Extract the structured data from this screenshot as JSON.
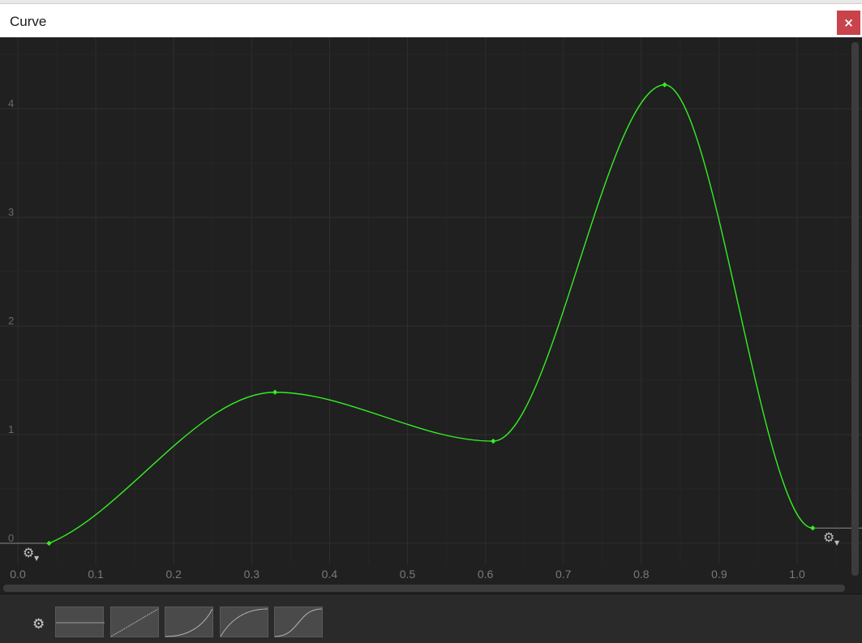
{
  "window": {
    "title": "Curve",
    "close_symbol": "×"
  },
  "chart_data": {
    "type": "line",
    "title": "",
    "xlabel": "",
    "ylabel": "",
    "xlim": [
      0.0,
      1.04
    ],
    "ylim": [
      -0.2,
      4.6
    ],
    "x_ticks": [
      "0.0",
      "0.1",
      "0.2",
      "0.3",
      "0.4",
      "0.5",
      "0.6",
      "0.7",
      "0.8",
      "0.9",
      "1.0"
    ],
    "y_ticks": [
      "0",
      "1",
      "2",
      "3",
      "4"
    ],
    "grid": true,
    "curve_color": "#33ee22",
    "series": [
      {
        "keys": [
          {
            "x": 0.04,
            "y": 0.0
          },
          {
            "x": 0.33,
            "y": 1.39
          },
          {
            "x": 0.61,
            "y": 0.94
          },
          {
            "x": 0.83,
            "y": 4.22
          },
          {
            "x": 1.02,
            "y": 0.14
          }
        ]
      }
    ]
  },
  "presets": [
    {
      "icon": "flat-preset-icon"
    },
    {
      "icon": "linear-preset-icon"
    },
    {
      "icon": "ease-in-preset-icon"
    },
    {
      "icon": "ease-out-preset-icon"
    },
    {
      "icon": "ease-in-out-preset-icon"
    }
  ],
  "icons": {
    "settings": "gear-icon",
    "gear_glyph": "⚙"
  }
}
